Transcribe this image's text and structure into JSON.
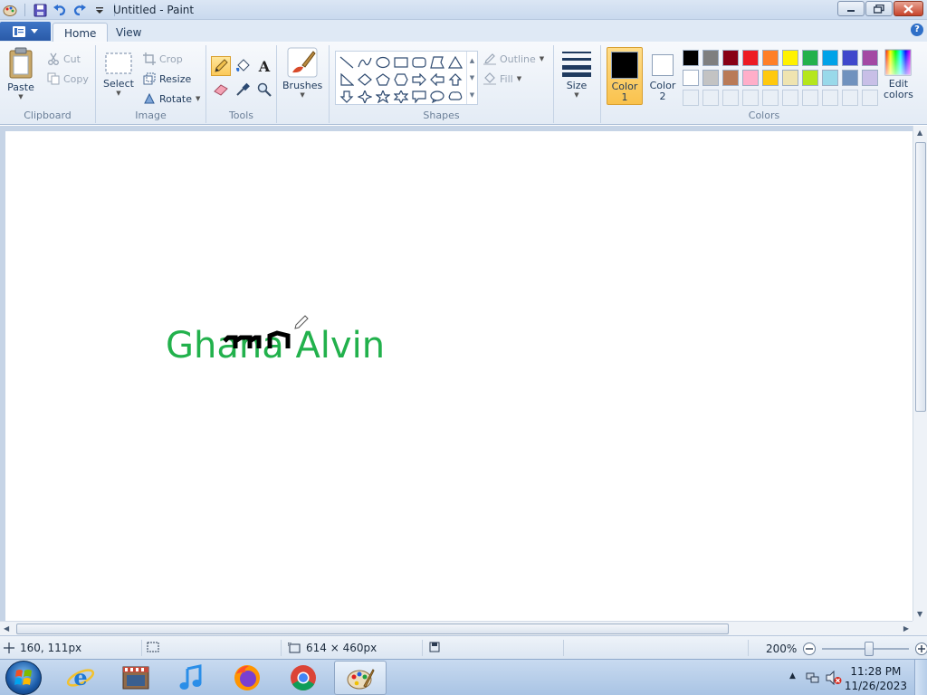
{
  "window": {
    "title": "Untitled - Paint"
  },
  "quick_access": [
    "save-icon",
    "undo-icon",
    "redo-icon",
    "customize-dropdown-icon"
  ],
  "tabs": {
    "home": "Home",
    "view": "View"
  },
  "ribbon": {
    "clipboard": {
      "label": "Clipboard",
      "paste": "Paste",
      "cut": "Cut",
      "copy": "Copy"
    },
    "image": {
      "label": "Image",
      "select": "Select",
      "crop": "Crop",
      "resize": "Resize",
      "rotate": "Rotate"
    },
    "tools": {
      "label": "Tools"
    },
    "brushes": {
      "label": "Brushes"
    },
    "shapes": {
      "label": "Shapes",
      "outline": "Outline",
      "fill": "Fill"
    },
    "size": {
      "label": "Size"
    },
    "colors": {
      "label": "Colors",
      "color1": "Color",
      "color1_num": "1",
      "color2": "Color",
      "color2_num": "2",
      "edit": "Edit",
      "edit2": "colors",
      "color1_value": "#000000",
      "color2_value": "#ffffff",
      "palette_row1": [
        "#000000",
        "#7f7f7f",
        "#880015",
        "#ed1c24",
        "#ff7f27",
        "#fff200",
        "#22b14c",
        "#00a2e8",
        "#3f48cc",
        "#a349a4"
      ],
      "palette_row2": [
        "#ffffff",
        "#c3c3c3",
        "#b97a57",
        "#ffaec9",
        "#ffc90e",
        "#efe4b0",
        "#b5e61d",
        "#99d9ea",
        "#7092be",
        "#c8bfe7"
      ]
    }
  },
  "canvas": {
    "text": "Ghana Alvin",
    "text_color": "#22b14c"
  },
  "status": {
    "position": "160, 111px",
    "canvas_size": "614 × 460px",
    "zoom": "200%",
    "zoom_level_fraction": 0.55
  },
  "taskbar": {
    "apps": [
      "internet-explorer-icon",
      "media-center-icon",
      "itunes-icon",
      "firefox-icon",
      "chrome-icon",
      "paint-icon"
    ],
    "time": "11:28 PM",
    "date": "11/26/2023"
  }
}
